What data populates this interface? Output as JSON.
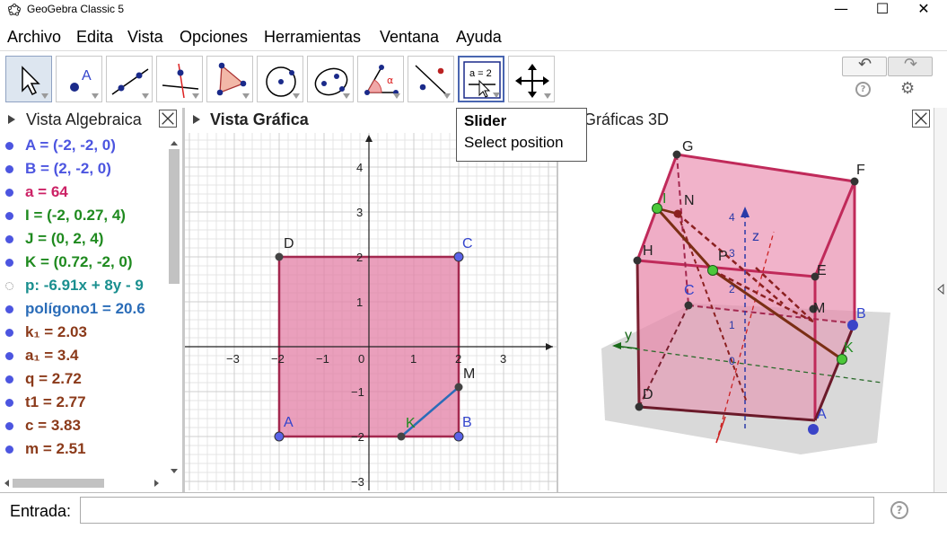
{
  "window": {
    "title": "GeoGebra Classic 5",
    "minimize": "—",
    "maximize": "☐",
    "close": "✕"
  },
  "menu": [
    "Archivo",
    "Edita",
    "Vista",
    "Opciones",
    "Herramientas",
    "Ventana",
    "Ayuda"
  ],
  "toolbar": {
    "tools": [
      {
        "name": "move-tool",
        "icon": "arrow-cursor-icon"
      },
      {
        "name": "point-tool",
        "icon": "point-icon",
        "label": "A"
      },
      {
        "name": "line-tool",
        "icon": "line-icon"
      },
      {
        "name": "perpendicular-tool",
        "icon": "perpendicular-line-icon"
      },
      {
        "name": "polygon-tool",
        "icon": "polygon-icon"
      },
      {
        "name": "circle-tool",
        "icon": "circle-icon"
      },
      {
        "name": "conic-tool",
        "icon": "ellipse-icon"
      },
      {
        "name": "angle-tool",
        "icon": "angle-icon",
        "label": "α"
      },
      {
        "name": "reflect-tool",
        "icon": "reflect-icon"
      },
      {
        "name": "slider-tool",
        "icon": "slider-icon",
        "label": "a = 2"
      },
      {
        "name": "move-graphics-tool",
        "icon": "move-arrows-icon"
      }
    ],
    "undo_icon": "↶",
    "redo_icon": "↷",
    "help_icon": "?",
    "settings_icon": "⚙"
  },
  "tooltip": {
    "title": "Slider",
    "body": "Select position"
  },
  "panels": {
    "algebra_title": "Vista Algebraica",
    "graphics_title": "Vista Gráfica",
    "graphics3d_title": "Gráficas 3D"
  },
  "algebra": {
    "items": [
      {
        "text": "A = (-2, -2, 0)",
        "color": "#4c55e0",
        "hollow": false
      },
      {
        "text": "B = (2, -2, 0)",
        "color": "#4c55e0",
        "hollow": false
      },
      {
        "text": "a = 64",
        "color": "#cc2266",
        "hollow": false
      },
      {
        "text": "I = (-2, 0.27, 4)",
        "color": "#1f8a1f",
        "hollow": false
      },
      {
        "text": "J = (0, 2, 4)",
        "color": "#1f8a1f",
        "hollow": false
      },
      {
        "text": "K = (0.72, -2, 0)",
        "color": "#1f8a1f",
        "hollow": false
      },
      {
        "text": "p: -6.91x + 8y - 9",
        "color": "#1a8f8f",
        "hollow": true
      },
      {
        "text": "polígono1 = 20.6",
        "color": "#2a6cb8",
        "hollow": false
      },
      {
        "text": "k₁ = 2.03",
        "color": "#8b3a1a",
        "hollow": false
      },
      {
        "text": "a₁ = 3.4",
        "color": "#8b3a1a",
        "hollow": false
      },
      {
        "text": "q = 2.72",
        "color": "#8b3a1a",
        "hollow": false
      },
      {
        "text": "t1 = 2.77",
        "color": "#8b3a1a",
        "hollow": false
      },
      {
        "text": "c = 3.83",
        "color": "#8b3a1a",
        "hollow": false
      },
      {
        "text": "m = 2.51",
        "color": "#8b3a1a",
        "hollow": false
      }
    ]
  },
  "graphics2d": {
    "x_ticks": [
      "−3",
      "−2",
      "−1",
      "0",
      "1",
      "2",
      "3"
    ],
    "y_ticks": [
      "4",
      "3",
      "2",
      "1",
      "−1",
      "−2",
      "−3"
    ],
    "points": {
      "A": "A",
      "B": "B",
      "C": "C",
      "D": "D",
      "M": "M",
      "K": "K"
    }
  },
  "graphics3d": {
    "labels": {
      "G": "G",
      "F": "F",
      "H": "H",
      "E": "E",
      "I": "I",
      "N": "N",
      "P": "P",
      "C": "C",
      "M": "M",
      "B": "B",
      "K": "K",
      "D": "D",
      "A": "A",
      "z": "z",
      "y": "y"
    },
    "z_ticks": [
      "4",
      "3",
      "2",
      "1",
      "0"
    ]
  },
  "input": {
    "label": "Entrada:",
    "value": "",
    "help": "?"
  },
  "colors": {
    "polygon_fill": "#e37fa6",
    "polygon_stroke": "#a3284f",
    "point_blue": "#4c55e0",
    "point_dark": "#333333",
    "segment_blue": "#2a6cb8",
    "cube_stroke": "#c02a5a",
    "cube_fill": "#e88aac"
  }
}
